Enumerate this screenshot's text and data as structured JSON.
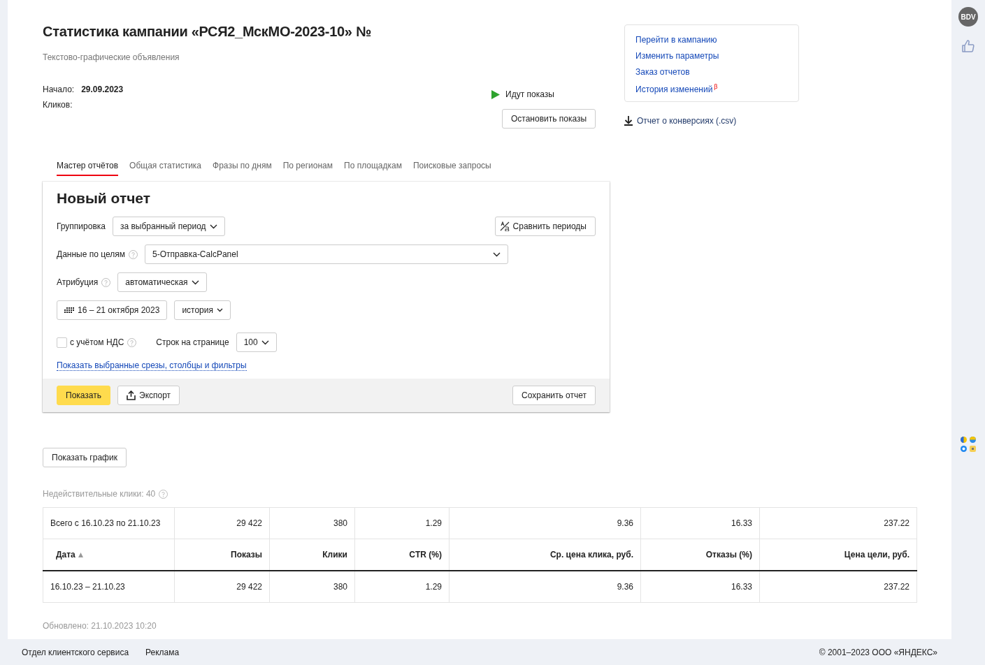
{
  "header": {
    "title": "Статистика кампании «РСЯ2_МскМО-2023-10» №",
    "subtitle": "Текстово-графические объявления",
    "start_label": "Начало:",
    "start_value": "29.09.2023",
    "clicks_label": "Кликов:"
  },
  "status": {
    "text": "Идут показы",
    "running": true,
    "stop_button": "Остановить показы"
  },
  "links": [
    {
      "label": "Перейти в кампанию"
    },
    {
      "label": "Изменить параметры"
    },
    {
      "label": "Заказ отчетов"
    },
    {
      "label": "История изменений",
      "badge": "β"
    }
  ],
  "conversions_link": "Отчет о конверсиях (.csv)",
  "tabs": [
    {
      "label": "Мастер отчётов",
      "selected": true
    },
    {
      "label": "Общая статистика",
      "selected": false
    },
    {
      "label": "Фразы по дням",
      "selected": false
    },
    {
      "label": "По регионам",
      "selected": false
    },
    {
      "label": "По площадкам",
      "selected": false
    },
    {
      "label": "Поисковые запросы",
      "selected": false
    }
  ],
  "report": {
    "title": "Новый отчет",
    "grouping_label": "Группировка",
    "grouping_value": "за выбранный период",
    "compare_button": "Сравнить периоды",
    "goals_label": "Данные по целям",
    "goals_value": "5-Отправка-CalcPanel",
    "attribution_label": "Атрибуция",
    "attribution_value": "автоматическая",
    "date_range": "16 – 21 октября 2023",
    "period_mode": "история",
    "vat_label": "с учётом НДС",
    "vat_checked": false,
    "rows_label": "Строк на странице",
    "rows_value": "100",
    "filters_link": "Показать выбранные срезы, столбцы и фильтры",
    "show_button": "Показать",
    "export_button": "Экспорт",
    "save_button": "Сохранить отчет"
  },
  "show_chart_button": "Показать график",
  "invalid_clicks": "Недействительные клики: 40",
  "table": {
    "total": [
      "Всего с 16.10.23 по 21.10.23",
      "29 422",
      "380",
      "1.29",
      "9.36",
      "16.33",
      "237.22"
    ],
    "columns": [
      {
        "label": "Дата",
        "sorted": true
      },
      {
        "label": "Показы",
        "sorted": false
      },
      {
        "label": "Клики",
        "sorted": false
      },
      {
        "label": "CTR (%)",
        "sorted": false
      },
      {
        "label": "Ср. цена клика, руб.",
        "sorted": false
      },
      {
        "label": "Отказы (%)",
        "sorted": false
      },
      {
        "label": "Цена цели, руб.",
        "sorted": false
      }
    ],
    "rows": [
      [
        "16.10.23 – 21.10.23",
        "29 422",
        "380",
        "1.29",
        "9.36",
        "16.33",
        "237.22"
      ]
    ]
  },
  "updated": "Обновлено: 21.10.2023 10:20",
  "footer": {
    "links": [
      "Отдел клиентского сервиса",
      "Реклама"
    ],
    "copyright": "© 2001–2023 ООО «ЯНДЕКС»"
  },
  "sidebar": {
    "avatar_text": "BDV"
  }
}
